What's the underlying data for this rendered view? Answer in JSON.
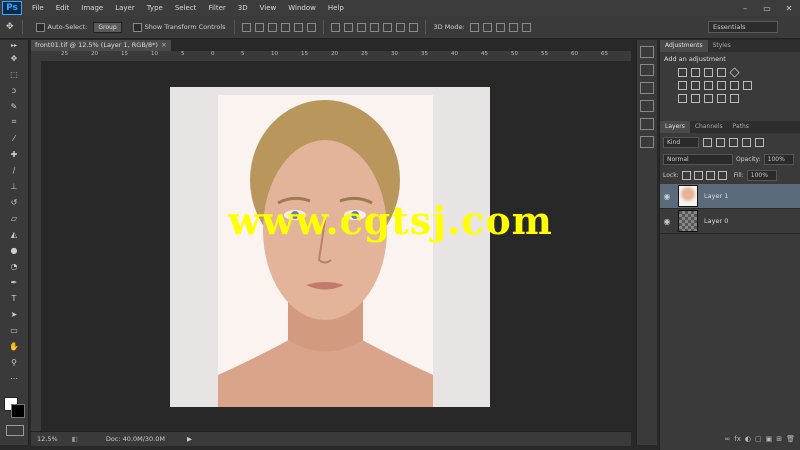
{
  "app": {
    "logo": "Ps"
  },
  "menu": [
    "File",
    "Edit",
    "Image",
    "Layer",
    "Type",
    "Select",
    "Filter",
    "3D",
    "View",
    "Window",
    "Help"
  ],
  "window_controls": [
    "–",
    "▭",
    "✕"
  ],
  "options": {
    "auto_select_label": "Auto-Select:",
    "auto_select_value": "Group",
    "show_transform_label": "Show Transform Controls",
    "mode_3d_label": "3D Mode:",
    "workspace": "Essentials"
  },
  "document": {
    "tab_title": "front01.tif @ 12.5% (Layer 1, RGB/8*)",
    "tab_close": "×",
    "ruler_ticks": [
      "25",
      "20",
      "15",
      "10",
      "5",
      "0",
      "5",
      "10",
      "15",
      "20",
      "25",
      "30",
      "35",
      "40",
      "45",
      "50",
      "55",
      "60",
      "65"
    ]
  },
  "watermark": "www.cgtsj.com",
  "status": {
    "zoom": "12.5%",
    "doc_info": "Doc: 40.0M/30.0M",
    "arrow": "▶"
  },
  "adjustments": {
    "tabs": [
      "Adjustments",
      "Styles"
    ],
    "title": "Add an adjustment"
  },
  "layers_panel": {
    "tabs": [
      "Layers",
      "Channels",
      "Paths"
    ],
    "filter_kind": "Kind",
    "blend_mode": "Normal",
    "opacity_label": "Opacity:",
    "opacity_value": "100%",
    "lock_label": "Lock:",
    "fill_label": "Fill:",
    "fill_value": "100%",
    "layers": [
      {
        "name": "Layer 1",
        "selected": true
      },
      {
        "name": "Layer 0",
        "selected": false
      }
    ],
    "bottom_icons": [
      "fx",
      "◐",
      "▢",
      "▣",
      "⊞",
      "🗑"
    ]
  },
  "colors": {
    "accent": "#31a8ff",
    "selected_layer": "#5c6b7c",
    "watermark": "#ffff00"
  }
}
